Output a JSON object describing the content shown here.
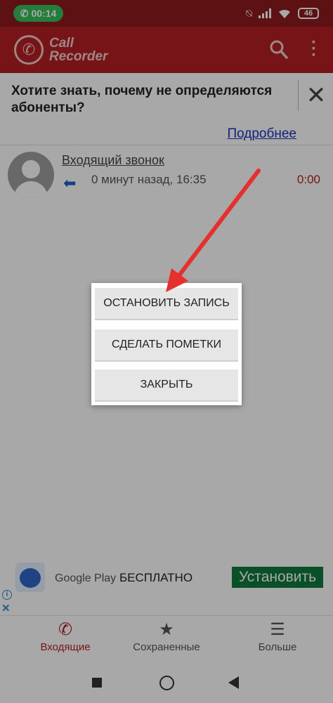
{
  "status_bar": {
    "call_time": "00:14",
    "battery": "46"
  },
  "app_bar": {
    "logo_line1": "Call",
    "logo_line2": "Recorder"
  },
  "banner": {
    "question": "Хотите знать, почему не определяются абоненты?",
    "more_link": "Подробнее"
  },
  "call": {
    "title": "Входящий звонок",
    "meta": "0 минут назад, 16:35",
    "duration": "0:00"
  },
  "dialog": {
    "stop_label": "ОСТАНОВИТЬ ЗАПИСЬ",
    "notes_label": "СДЕЛАТЬ ПОМЕТКИ",
    "close_label": "ЗАКРЫТЬ"
  },
  "ad": {
    "store": "Google Play",
    "price": "БЕСПЛАТНО",
    "install_label": "Установить"
  },
  "bottom_nav": {
    "items": [
      {
        "label": "Входящие",
        "icon": "phone-icon"
      },
      {
        "label": "Сохраненные",
        "icon": "star-icon"
      },
      {
        "label": "Больше",
        "icon": "menu-icon"
      }
    ]
  },
  "colors": {
    "app_bar": "#b41f24",
    "status_bar": "#8f1a1c",
    "call_pill": "#36c05a",
    "link": "#1a35c0",
    "install_button": "#0f7a3f",
    "annotation_arrow": "#e5302e"
  }
}
